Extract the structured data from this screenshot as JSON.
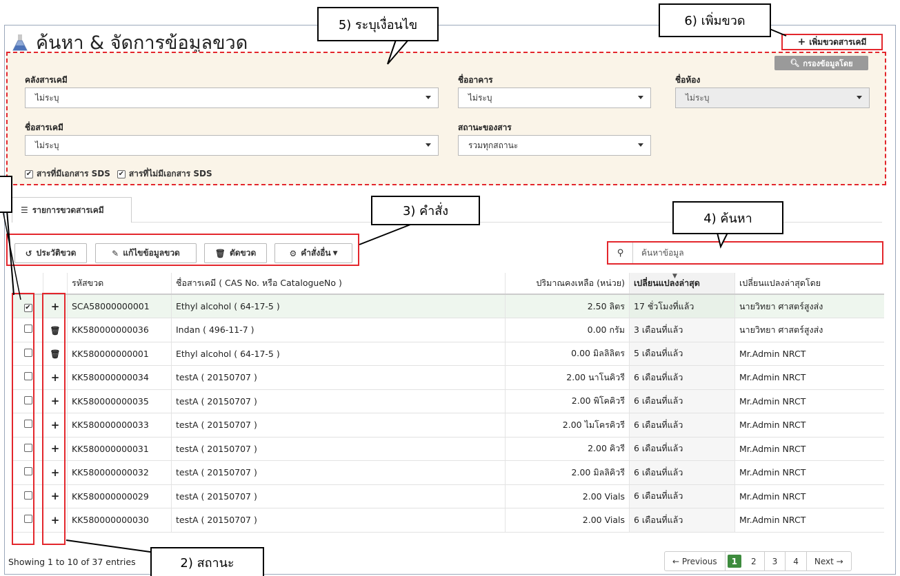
{
  "header": {
    "title": "ค้นหา & จัดการข้อมูลขวด",
    "add_button": "เพิ่มขวดสารเคมี",
    "filter_chip": "กรองข้อมูลโดย"
  },
  "filters": {
    "warehouse": {
      "label": "คลังสารเคมี",
      "value": "ไม่ระบุ"
    },
    "building": {
      "label": "ชื่ออาคาร",
      "value": "ไม่ระบุ"
    },
    "room": {
      "label": "ชื่อห้อง",
      "value": "ไม่ระบุ"
    },
    "chemical": {
      "label": "ชื่อสารเคมี",
      "value": "ไม่ระบุ"
    },
    "status": {
      "label": "สถานะของสาร",
      "value": "รวมทุกสถานะ"
    },
    "sds_yes": "สารที่มีเอกสาร SDS",
    "sds_no": "สารที่ไม่มีเอกสาร SDS"
  },
  "tab": {
    "label": "รายการขวดสารเคมี"
  },
  "commands": {
    "history": "ประวัติขวด",
    "edit": "แก้ไขข้อมูลขวด",
    "cut": "ตัดขวด",
    "more": "คำสั่งอื่น"
  },
  "search": {
    "placeholder": "ค้นหาข้อมูล"
  },
  "table": {
    "headers": {
      "code": "รหัสขวด",
      "name": "ชื่อสารเคมี ( CAS No. หรือ CatalogueNo )",
      "amount": "ปริมาณคงเหลือ (หน่วย)",
      "changed": "เปลี่ยนแปลงล่าสุด",
      "changed_by": "เปลี่ยนแปลงล่าสุดโดย"
    },
    "rows": [
      {
        "checked": true,
        "status": "plus",
        "code": "SCA58000000001",
        "name": "Ethyl alcohol ( 64-17-5 )",
        "amount": "2.50 ลิตร",
        "changed": "17 ชั่วโมงที่แล้ว",
        "by": "นายวิทยา ศาสตร์สูงส่ง"
      },
      {
        "checked": false,
        "status": "trash",
        "code": "KK580000000036",
        "name": "Indan ( 496-11-7 )",
        "amount": "0.00 กรัม",
        "changed": "3 เดือนที่แล้ว",
        "by": "นายวิทยา ศาสตร์สูงส่ง"
      },
      {
        "checked": false,
        "status": "trash",
        "code": "KK580000000001",
        "name": "Ethyl alcohol ( 64-17-5 )",
        "amount": "0.00 มิลลิลิตร",
        "changed": "5 เดือนที่แล้ว",
        "by": "Mr.Admin NRCT"
      },
      {
        "checked": false,
        "status": "plus",
        "code": "KK580000000034",
        "name": "testA ( 20150707 )",
        "amount": "2.00 นาโนคิวรี",
        "changed": "6 เดือนที่แล้ว",
        "by": "Mr.Admin NRCT"
      },
      {
        "checked": false,
        "status": "plus",
        "code": "KK580000000035",
        "name": "testA ( 20150707 )",
        "amount": "2.00 พิโคคิวรี",
        "changed": "6 เดือนที่แล้ว",
        "by": "Mr.Admin NRCT"
      },
      {
        "checked": false,
        "status": "plus",
        "code": "KK580000000033",
        "name": "testA ( 20150707 )",
        "amount": "2.00 ไมโครคิวรี",
        "changed": "6 เดือนที่แล้ว",
        "by": "Mr.Admin NRCT"
      },
      {
        "checked": false,
        "status": "plus",
        "code": "KK580000000031",
        "name": "testA ( 20150707 )",
        "amount": "2.00 คิวรี",
        "changed": "6 เดือนที่แล้ว",
        "by": "Mr.Admin NRCT"
      },
      {
        "checked": false,
        "status": "plus",
        "code": "KK580000000032",
        "name": "testA ( 20150707 )",
        "amount": "2.00 มิลลิคิวรี",
        "changed": "6 เดือนที่แล้ว",
        "by": "Mr.Admin NRCT"
      },
      {
        "checked": false,
        "status": "plus",
        "code": "KK580000000029",
        "name": "testA ( 20150707 )",
        "amount": "2.00 Vials",
        "changed": "6 เดือนที่แล้ว",
        "by": "Mr.Admin NRCT"
      },
      {
        "checked": false,
        "status": "plus",
        "code": "KK580000000030",
        "name": "testA ( 20150707 )",
        "amount": "2.00 Vials",
        "changed": "6 เดือนที่แล้ว",
        "by": "Mr.Admin NRCT"
      }
    ]
  },
  "footer": {
    "info": "Showing 1 to 10 of 37 entries"
  },
  "pagination": {
    "prev": "← Previous",
    "pages": [
      "1",
      "2",
      "3",
      "4"
    ],
    "active": "1",
    "next": "Next →"
  },
  "callouts": {
    "c2": "2) สถานะ",
    "c3": "3) คำสั่ง",
    "c4": "4) ค้นหา",
    "c5": "5) ระบุเงื่อนไข",
    "c6": "6) เพิ่มขวด"
  },
  "colors": {
    "annotation_red": "#e3262c",
    "filter_bg": "#faf4e8",
    "active_page": "#3d8b3d"
  }
}
